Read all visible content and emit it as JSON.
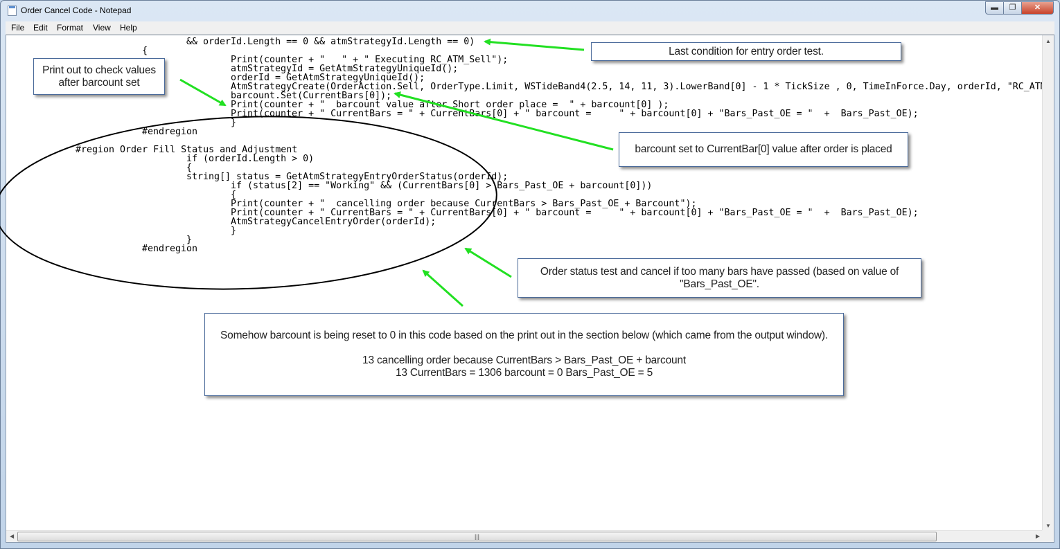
{
  "window": {
    "title": "Order Cancel Code - Notepad",
    "min": "▬",
    "max": "❐",
    "close": "✕"
  },
  "menu": [
    "File",
    "Edit",
    "Format",
    "View",
    "Help"
  ],
  "code": [
    "&& orderId.Length == 0 && atmStrategyId.Length == 0)",
    "{",
    "Print(counter + \"   \" + \" Executing RC_ATM_Sell\");",
    "atmStrategyId = GetAtmStrategyUniqueId();",
    "orderId = GetAtmStrategyUniqueId();",
    "AtmStrategyCreate(OrderAction.Sell, OrderType.Limit, WSTideBand4(2.5, 14, 11, 3).LowerBand[0] - 1 * TickSize , 0, TimeInForce.Day, orderId, \"RC_ATM",
    "barcount.Set(CurrentBars[0]);",
    "Print(counter + \"  barcount value after Short order place =  \" + barcount[0] );",
    "Print(counter + \" CurrentBars = \" + CurrentBars[0] + \" barcount =     \" + barcount[0] + \"Bars_Past_OE = \"  +  Bars_Past_OE);",
    "}",
    "#endregion",
    "#region Order Fill Status and Adjustment",
    "if (orderId.Length > 0)",
    "{",
    "string[] status = GetAtmStrategyEntryOrderStatus(orderId);",
    "if (status[2] == \"Working\" && (CurrentBars[0] > Bars_Past_OE + barcount[0]))",
    "{",
    "Print(counter + \"  cancelling order because CurrentBars > Bars_Past_OE + Barcount\");",
    "Print(counter + \" CurrentBars = \" + CurrentBars[0] + \" barcount =     \" + barcount[0] + \"Bars_Past_OE = \"  +  Bars_Past_OE);",
    "AtmStrategyCancelEntryOrder(orderId);",
    "}",
    "}",
    "#endregion"
  ],
  "callouts": {
    "last_condition": "Last condition for entry order test.",
    "print_out": [
      "Print out to check values",
      "after barcount set"
    ],
    "barcount_set": "barcount set to CurrentBar[0] value after order is placed",
    "order_status": [
      "Order status test and cancel if too many bars have passed (based on value of",
      "\"Bars_Past_OE\"."
    ],
    "reset": [
      "Somehow barcount is being reset to 0 in this code based on the print out in the section below (which came from the output window).",
      "13 cancelling order because CurrentBars > Bars_Past_OE + barcount",
      "13 CurrentBars = 1306  barcount = 0  Bars_Past_OE = 5"
    ]
  },
  "colors": {
    "arrow": "#22e022",
    "ellipse": "#000000",
    "callout_border": "#4a6a9a"
  }
}
